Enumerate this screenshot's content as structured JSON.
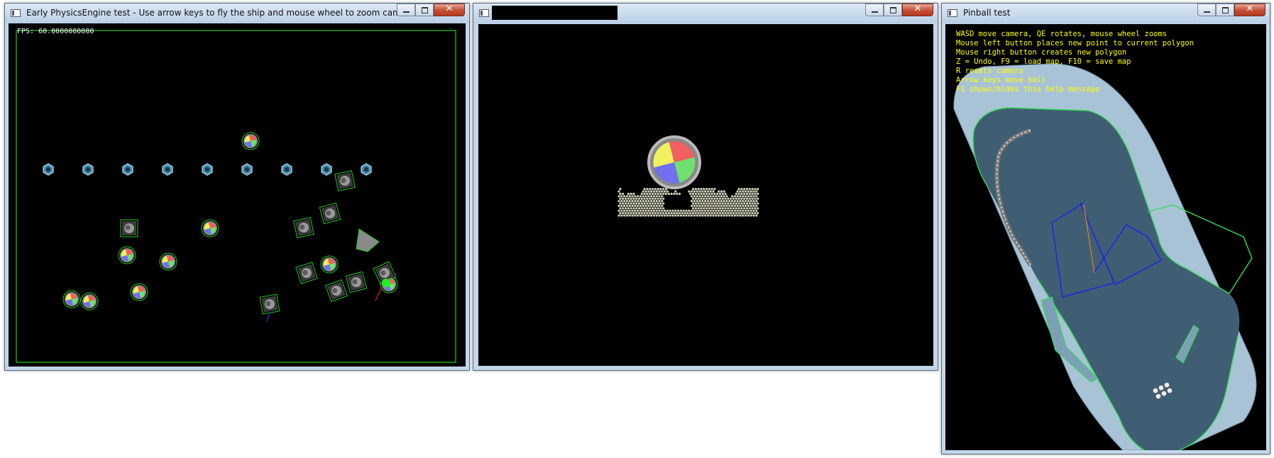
{
  "windows": [
    {
      "title": "Early PhysicsEngine test - Use arrow keys to fly the ship and mouse wheel to zoom camera",
      "fps_text": "FPS: 60.0000000000",
      "icons": {
        "app": "app-window-icon",
        "minimize": "minimize-icon",
        "maximize": "maximize-icon",
        "close": "close-icon"
      }
    },
    {
      "title": "",
      "title_redacted": true,
      "icons": {
        "app": "app-window-icon",
        "minimize": "minimize-icon",
        "maximize": "maximize-icon",
        "close": "close-icon"
      }
    },
    {
      "title": "Pinball test",
      "help_lines": [
        "WASD move camera, QE rotates, mouse wheel zooms",
        "Mouse left button places new point to current polygon",
        "Mouse right button creates new polygon",
        "Z = Undo, F9 = load map, F10 = save map",
        "R resets camera",
        "Arrow keys move ball",
        "F1 shows/hides this help message"
      ],
      "icons": {
        "app": "app-window-icon",
        "minimize": "minimize-icon",
        "maximize": "maximize-icon",
        "close": "close-icon"
      }
    }
  ],
  "colors": {
    "outline_green": "#22cc22",
    "help_text": "#ffff00",
    "polygon_blue": "#1a1aff",
    "ball_red": "#f06060",
    "ball_yellow": "#f0f060",
    "ball_blue": "#7070f0",
    "ball_green": "#70e070",
    "pinball_table": "#a9c3d6",
    "pinball_inner": "#3f5e73"
  }
}
